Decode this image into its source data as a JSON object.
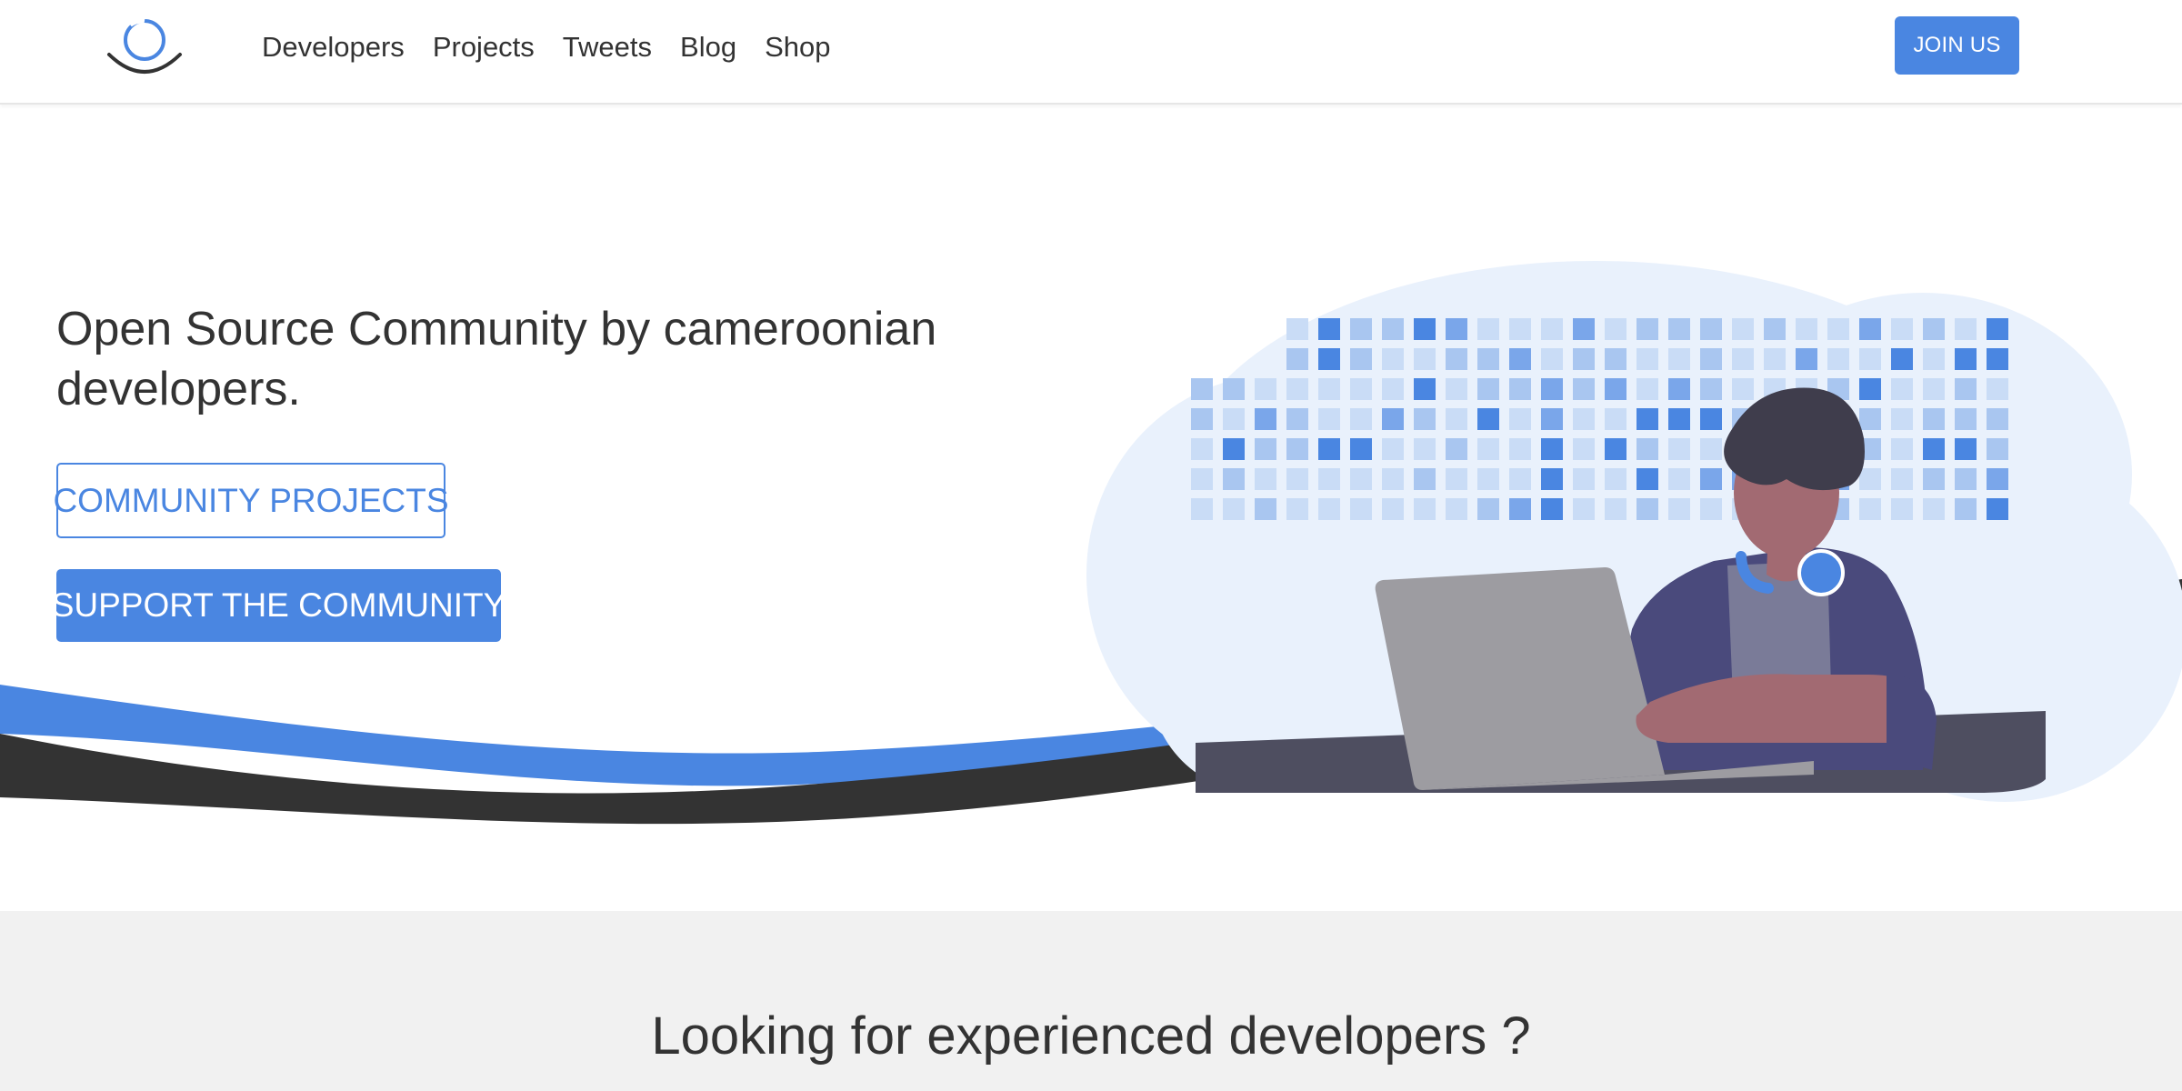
{
  "nav": {
    "logo_icon": "community-logo-icon",
    "links": [
      "Developers",
      "Projects",
      "Tweets",
      "Blog",
      "Shop"
    ],
    "join_label": "JOIN US"
  },
  "hero": {
    "title": "Open Source Community by cameroonian developers.",
    "community_projects_label": "COMMUNITY PROJECTS",
    "support_label": "SUPPORT THE COMMUNITY",
    "illustration_icon": "developer-with-laptop-illustration"
  },
  "section_two": {
    "heading": "Looking for experienced developers ?"
  },
  "colors": {
    "accent": "#4a86e1",
    "text": "#333333",
    "section_bg": "#f1f1f1",
    "cloud": "#e9f1fc"
  }
}
